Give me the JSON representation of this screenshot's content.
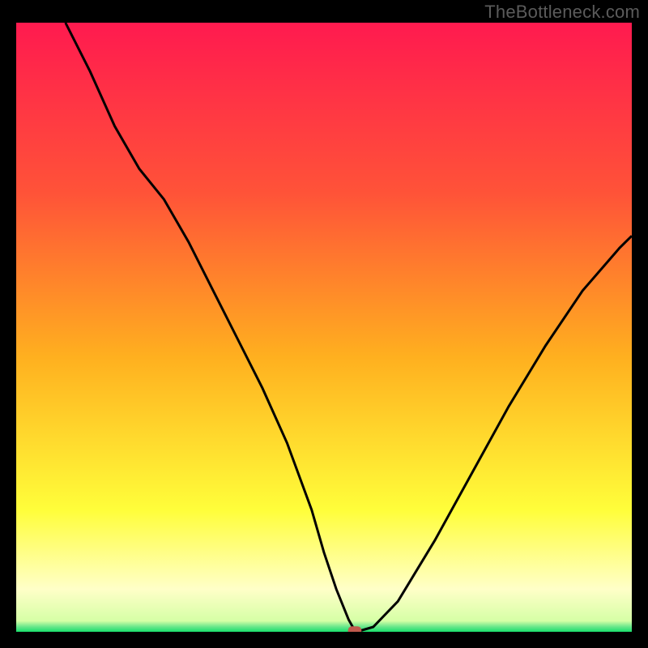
{
  "watermark": "TheBottleneck.com",
  "gradient_stops": [
    {
      "offset": 0.0,
      "color": "#ff1a4f"
    },
    {
      "offset": 0.28,
      "color": "#ff5338"
    },
    {
      "offset": 0.55,
      "color": "#ffb01f"
    },
    {
      "offset": 0.8,
      "color": "#fffe3a"
    },
    {
      "offset": 0.93,
      "color": "#ffffc8"
    },
    {
      "offset": 0.982,
      "color": "#d6ffa6"
    },
    {
      "offset": 0.992,
      "color": "#65e68a"
    },
    {
      "offset": 1.0,
      "color": "#19e06c"
    }
  ],
  "chart_data": {
    "type": "line",
    "title": "",
    "xlabel": "",
    "ylabel": "",
    "xlim": [
      0,
      100
    ],
    "ylim": [
      0,
      100
    ],
    "x": [
      8,
      12,
      16,
      20,
      24,
      28,
      32,
      36,
      40,
      44,
      48,
      50,
      52,
      54,
      55,
      56,
      58,
      62,
      68,
      74,
      80,
      86,
      92,
      98,
      100
    ],
    "values": [
      100,
      92,
      83,
      76,
      71,
      64,
      56,
      48,
      40,
      31,
      20,
      13,
      7,
      2,
      0.2,
      0.2,
      0.8,
      5,
      15,
      26,
      37,
      47,
      56,
      63,
      65
    ],
    "marker": {
      "x": 55,
      "y": 0.2,
      "color": "#c05a4d",
      "width_x": 2.2,
      "height_y": 1.4
    },
    "notes": "Bottleneck-style V curve; values estimated from image pixels. y=0 at bottom green band, y=100 at top magenta."
  }
}
